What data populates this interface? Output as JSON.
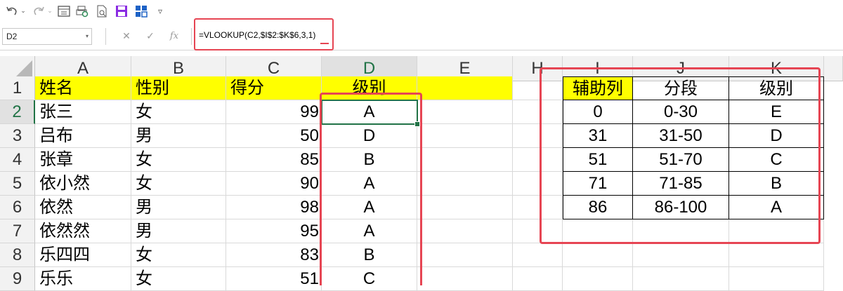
{
  "toolbar": {
    "undo_icon": "undo-icon",
    "redo_icon": "redo-icon",
    "customize_glyph": "▿"
  },
  "formula_bar": {
    "name_box": "D2",
    "cancel_glyph": "✕",
    "enter_glyph": "✓",
    "fx_glyph": "fx",
    "formula": "=VLOOKUP(C2,$I$2:$K$6,3,1)"
  },
  "columns": [
    "A",
    "B",
    "C",
    "D",
    "E",
    "H",
    "I",
    "J",
    "K"
  ],
  "rows": [
    "1",
    "2",
    "3",
    "4",
    "5",
    "6",
    "7",
    "8",
    "9"
  ],
  "main_table": {
    "headers": [
      "姓名",
      "性别",
      "得分",
      "级别"
    ],
    "rows": [
      [
        "张三",
        "女",
        "99",
        "A"
      ],
      [
        "吕布",
        "男",
        "50",
        "D"
      ],
      [
        "张章",
        "女",
        "85",
        "B"
      ],
      [
        "依小然",
        "女",
        "90",
        "A"
      ],
      [
        "依然",
        "男",
        "98",
        "A"
      ],
      [
        "依然然",
        "男",
        "95",
        "A"
      ],
      [
        "乐四四",
        "女",
        "83",
        "B"
      ],
      [
        "乐乐",
        "女",
        "51",
        "C"
      ]
    ]
  },
  "lookup_table": {
    "headers": [
      "辅助列",
      "分段",
      "级别"
    ],
    "rows": [
      [
        "0",
        "0-30",
        "E"
      ],
      [
        "31",
        "31-50",
        "D"
      ],
      [
        "51",
        "51-70",
        "C"
      ],
      [
        "71",
        "71-85",
        "B"
      ],
      [
        "86",
        "86-100",
        "A"
      ]
    ]
  },
  "colors": {
    "highlight_yellow": "#ffff00",
    "annotation_red": "#e64553",
    "selection_green": "#217346"
  }
}
